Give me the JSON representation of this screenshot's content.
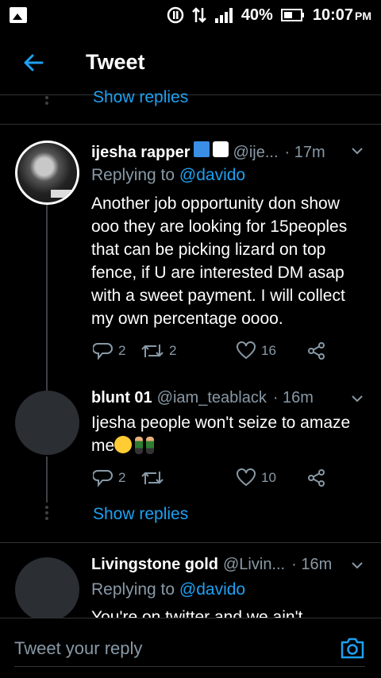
{
  "status_bar": {
    "battery": "40%",
    "time": "10:07",
    "ampm": "PM"
  },
  "header": {
    "title": "Tweet"
  },
  "thread": {
    "show_replies_top": "Show replies",
    "tweets": [
      {
        "name": "ijesha rapper",
        "handle": "@ije...",
        "time": "· 17m",
        "replying_label": "Replying to ",
        "replying_to": "@davido",
        "text": "Another job opportunity don show ooo they are looking for 15peoples that can be picking lizard on top fence, if U are interested DM asap with a sweet payment. I will collect my own percentage oooo.",
        "replies": "2",
        "retweets": "2",
        "likes": "16"
      },
      {
        "name": "blunt 01",
        "handle": "@iam_teablack",
        "time": "· 16m",
        "text_line1": "Ijesha people won't seize to amaze",
        "text_line2": "me",
        "replies": "2",
        "retweets": "",
        "likes": "10"
      },
      {
        "name": "Livingstone gold",
        "handle": "@Livin...",
        "time": "· 16m",
        "replying_label": "Replying to ",
        "replying_to": "@davido",
        "text_partial": "You're on twitter and we ain't"
      }
    ],
    "show_replies_mid": "Show replies"
  },
  "reply_bar": {
    "placeholder": "Tweet your reply"
  },
  "colors": {
    "accent": "#1da1f2",
    "muted": "#8899a6",
    "divider": "#2f3336"
  },
  "icons": [
    "gallery-icon",
    "back-arrow-icon",
    "chevron-down-icon",
    "reply-icon",
    "retweet-icon",
    "heart-icon",
    "share-icon",
    "camera-icon"
  ]
}
